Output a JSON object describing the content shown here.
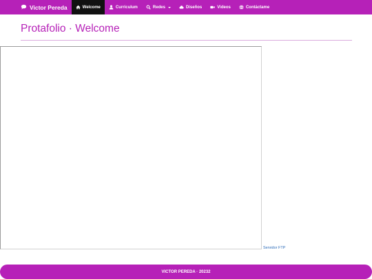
{
  "theme": {
    "accent": "#b621b8",
    "active_nav_bg": "#111111",
    "link": "#2a6ab8"
  },
  "navbar": {
    "brand": {
      "label": "Victor Pereda",
      "icon": "chat-bubble-icon"
    },
    "items": [
      {
        "label": "Welcome",
        "icon": "home-icon",
        "active": true
      },
      {
        "label": "Curriculum",
        "icon": "user-icon"
      },
      {
        "label": "Redes",
        "icon": "search-icon",
        "dropdown": true
      },
      {
        "label": "Diseños",
        "icon": "cloud-icon"
      },
      {
        "label": "Videos",
        "icon": "video-camera-icon"
      },
      {
        "label": "Contáctame",
        "icon": "globe-icon"
      }
    ]
  },
  "page": {
    "title": "Protafolio · Welcome"
  },
  "embed": {
    "side_link": "Servidor FTP"
  },
  "footer": {
    "text": "VICTOR PEREDA · 20232"
  }
}
